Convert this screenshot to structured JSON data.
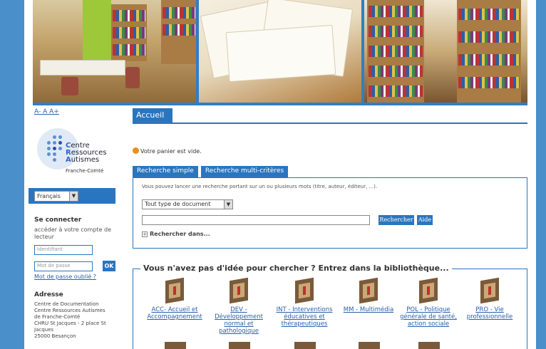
{
  "text_size_controls": [
    "A-",
    "A",
    "A+"
  ],
  "logo": {
    "lines": [
      {
        "initial": "C",
        "rest": "entre"
      },
      {
        "initial": "R",
        "rest": "essources"
      },
      {
        "initial": "A",
        "rest": "utismes"
      }
    ],
    "region": "Franche-Comté"
  },
  "language": {
    "selected": "Français",
    "arrow": "▼"
  },
  "login": {
    "title": "Se connecter",
    "hint": "accéder à votre compte de lecteur",
    "id_placeholder": "Identifiant",
    "password_placeholder": "Mot de passe",
    "ok_label": "OK",
    "forgot_label": "Mot de passe oublié ?"
  },
  "address": {
    "title": "Adresse",
    "lines": [
      "Centre de Documentation",
      "Centre Ressources Autismes",
      "de Franche-Comté",
      "CHRU St Jacques - 2 place St",
      "Jacques",
      "25000 Besançon"
    ]
  },
  "main": {
    "tab_title": "Accueil",
    "cart_status": "Votre panier est vide.",
    "search_tabs": [
      "Recherche simple",
      "Recherche multi-critères"
    ],
    "search_hint": "Vous pouvez lancer une recherche portant sur un ou plusieurs mots (titre, auteur, éditeur, ...).",
    "doc_type_selected": "Tout type de document",
    "doc_type_arrow": "▼",
    "search_button": "Rechercher",
    "help_button": "Aide",
    "search_in_label": "Rechercher dans...",
    "search_in_toggle": "+"
  },
  "library": {
    "legend": "Vous n'avez pas d'idée pour chercher ? Entrez dans la bibliothèque...",
    "shelves": [
      {
        "label": "ACC- Accueil et Accompagnement"
      },
      {
        "label": "DEV - Développement normal et pathologique"
      },
      {
        "label": "INT - Interventions éducatives et thérapeutiques"
      },
      {
        "label": "MM - Multimédia"
      },
      {
        "label": "POL - Politique générale de santé, action sociale"
      },
      {
        "label": "PRO - Vie professionnelle"
      }
    ]
  },
  "colors": {
    "accent": "#2a75bf",
    "page_background": "#4a8fc9",
    "link": "#2a5fa8"
  }
}
